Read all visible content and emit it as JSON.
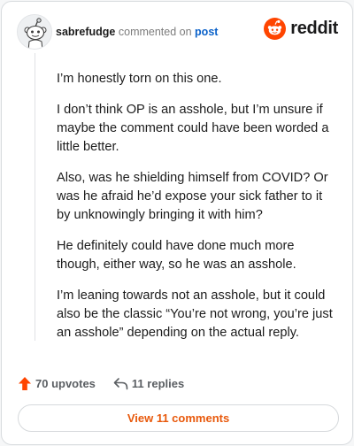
{
  "comment": {
    "username": "sabrefudge",
    "action_text": "commented on",
    "target_link": "post",
    "paragraphs": [
      "I’m honestly torn on this one.",
      "I don’t think OP is an asshole, but I’m unsure if maybe the comment could have been worded a little better.",
      "Also, was he shielding himself from COVID? Or was he afraid he’d expose your sick father to it by unknowingly bringing it with him?",
      "He definitely could have done much more though, either way, so he was an asshole.",
      "I’m leaning towards not an asshole, but it could also be the classic “You’re not wrong, you’re just an asshole” depending on the actual reply."
    ]
  },
  "brand": {
    "wordmark": "reddit",
    "icon": "reddit-snoo-icon",
    "color": "#ff4500"
  },
  "footer": {
    "upvotes_label": "70 upvotes",
    "replies_label": "11 replies",
    "view_comments_label": "View 11 comments",
    "upvote_icon": "upvote-arrow-icon",
    "reply_icon": "reply-arrow-icon"
  },
  "colors": {
    "accent": "#ff4500",
    "link": "#0a61c9",
    "button_text": "#e8590c"
  }
}
